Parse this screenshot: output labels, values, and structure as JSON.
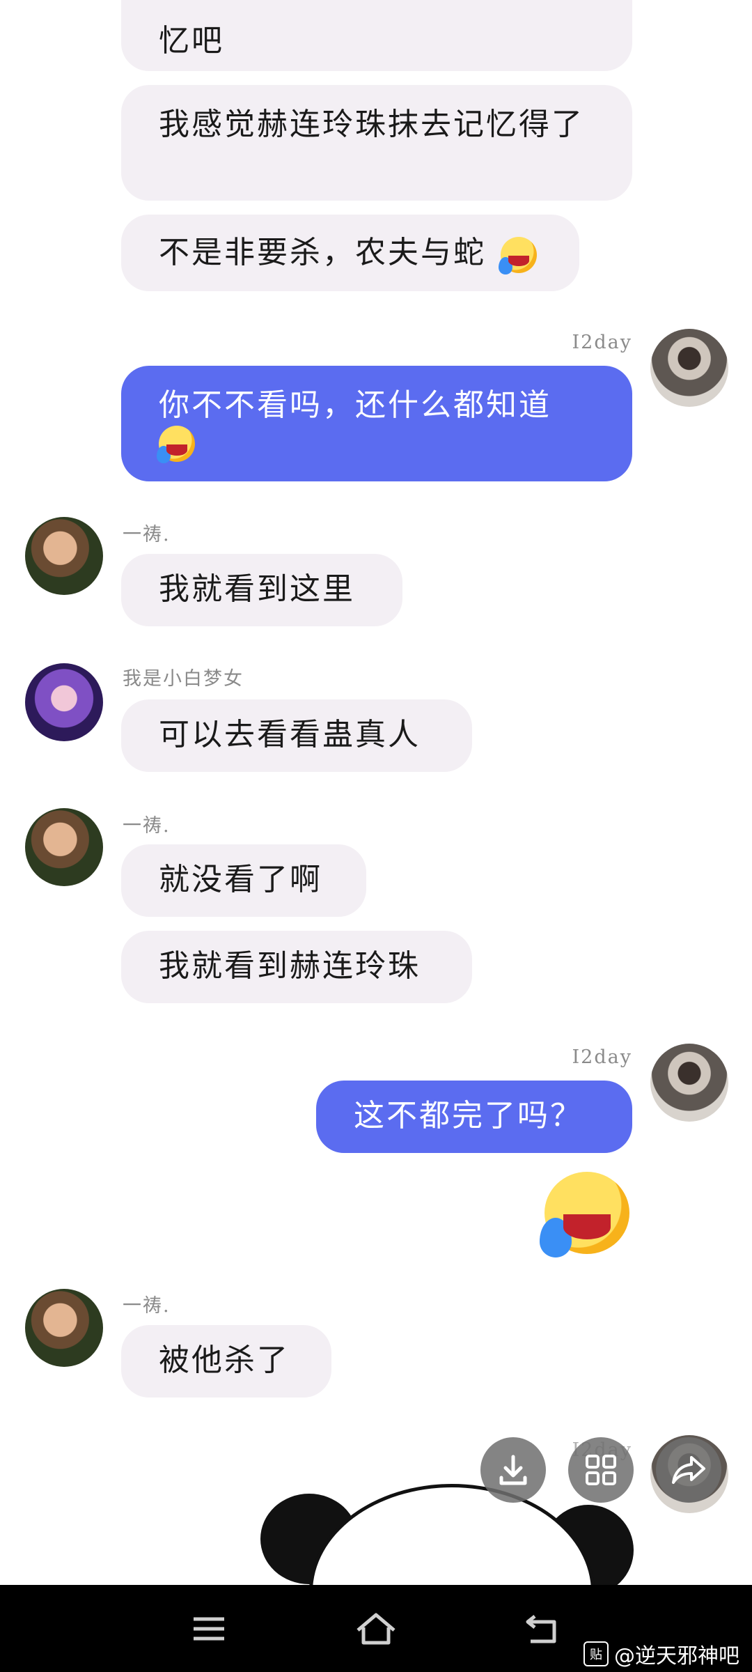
{
  "messages": [
    {
      "id": "m0",
      "text": "明显要被他杀了，或者抹去记忆吧",
      "visible_text": "忆吧"
    },
    {
      "id": "m1",
      "text": "我感觉赫连玲珠抹去记忆得了"
    },
    {
      "id": "m2",
      "text": "不是非要杀，农夫与蛇"
    },
    {
      "id": "m3",
      "sender": "I2day",
      "text": "你不不看吗，还什么都知道"
    },
    {
      "id": "m4",
      "sender": "一祷.",
      "text": "我就看到这里"
    },
    {
      "id": "m5",
      "sender": "我是小白梦女",
      "text": "可以去看看蛊真人"
    },
    {
      "id": "m6",
      "sender": "一祷.",
      "text": "就没看了啊"
    },
    {
      "id": "m7",
      "text": "我就看到赫连玲珠"
    },
    {
      "id": "m8",
      "sender": "I2day",
      "text": "这不都完了吗？"
    },
    {
      "id": "m9",
      "sender": "一祷.",
      "text": "被他杀了"
    }
  ],
  "last_sender_partial": "I2day",
  "watermark": {
    "badge": "贴",
    "text": "@逆天邪神吧"
  },
  "colors": {
    "mine_bubble": "#5b6cf0",
    "other_bubble": "#f3eff4",
    "navbar": "#000000"
  },
  "icons": [
    "download-icon",
    "grid-icon",
    "share-icon",
    "menu-icon",
    "home-icon",
    "back-icon",
    "laughing-crying-emoji",
    "panda-sticker"
  ]
}
